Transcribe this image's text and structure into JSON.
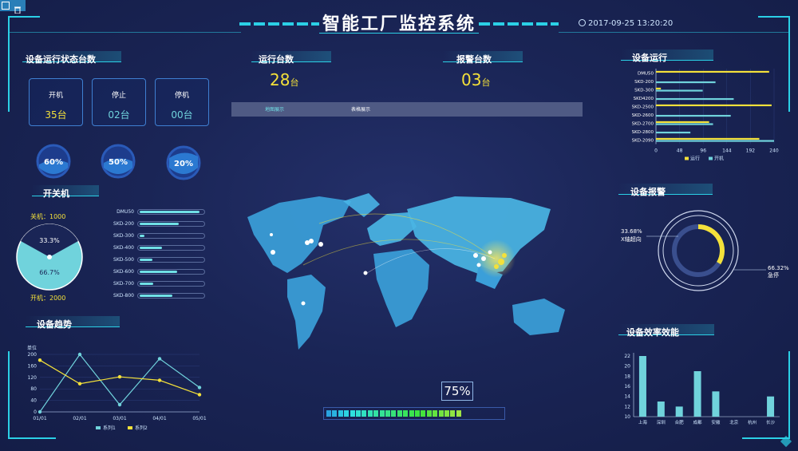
{
  "title": "智能工厂监控系统",
  "datetime": "2017-09-25 13:20:20",
  "colors": {
    "accent": "#2bd0e6",
    "yellow": "#f4e13a",
    "cyan": "#70d3dc",
    "bg": "#1a2556"
  },
  "toolbar": {
    "icons": [
      "window-icon",
      "trash-icon"
    ]
  },
  "device_status": {
    "title": "设备运行状态台数",
    "boxes": [
      {
        "label": "开机",
        "value": "35台",
        "color": "#f4e13a"
      },
      {
        "label": "停止",
        "value": "02台",
        "color": "#70d3dc"
      },
      {
        "label": "停机",
        "value": "00台",
        "color": "#70d3dc"
      }
    ],
    "rings": [
      "60%",
      "50%",
      "20%"
    ]
  },
  "power": {
    "title": "开关机",
    "off_label": "关机：1000",
    "on_label": "开机：2000",
    "off_pct": "33.3%",
    "on_pct": "66.7%",
    "bars": [
      {
        "label": "DMU50",
        "value": 0.95
      },
      {
        "label": "SKD-200",
        "value": 0.62
      },
      {
        "label": "SKD-300",
        "value": 0.08
      },
      {
        "label": "SKD-400",
        "value": 0.35
      },
      {
        "label": "SKD-500",
        "value": 0.2
      },
      {
        "label": "SKD-600",
        "value": 0.6
      },
      {
        "label": "SKD-700",
        "value": 0.22
      },
      {
        "label": "SKD-800",
        "value": 0.52
      }
    ]
  },
  "center": {
    "running_title": "运行台数",
    "running_value": "28",
    "alarm_title": "报警台数",
    "alarm_value": "03",
    "unit": "台",
    "tabs": [
      "地图展示",
      "表格展示"
    ],
    "progress_label": "75%",
    "progress_value": 0.75
  },
  "trend": {
    "title": "设备趋势",
    "unit_label": "单位",
    "legend": [
      "系列1",
      "系列2"
    ]
  },
  "device_running": {
    "title": "设备运行",
    "legend": [
      "运行",
      "开机"
    ]
  },
  "alarm": {
    "title": "设备报警",
    "left_pct": "33.68%",
    "left_label": "X轴超向",
    "right_pct": "66.32%",
    "right_label": "急停"
  },
  "efficiency": {
    "title": "设备效率效能"
  },
  "chart_data": [
    {
      "type": "line",
      "title": "设备趋势",
      "ylabel": "单位",
      "categories": [
        "01/01",
        "02/01",
        "03/01",
        "04/01",
        "05/01"
      ],
      "ylim": [
        0,
        200
      ],
      "yticks": [
        0,
        40,
        80,
        120,
        160,
        200
      ],
      "series": [
        {
          "name": "系列1",
          "color": "#70d3dc",
          "values": [
            0,
            200,
            25,
            185,
            85
          ]
        },
        {
          "name": "系列2",
          "color": "#f4e13a",
          "values": [
            180,
            98,
            122,
            110,
            60
          ]
        }
      ]
    },
    {
      "type": "bar",
      "title": "设备运行",
      "categories": [
        "DMU50",
        "SKD-200",
        "SKD-300",
        "SKD4200",
        "SKD-2500",
        "SKD-2600",
        "SKD-2700",
        "SKD-2800",
        "SKD-2090"
      ],
      "xlim": [
        0,
        240
      ],
      "xticks": [
        0,
        48,
        96,
        144,
        192,
        240
      ],
      "series": [
        {
          "name": "运行",
          "color": "#f4e13a",
          "values": [
            230,
            0,
            10,
            0,
            235,
            0,
            108,
            0,
            210
          ]
        },
        {
          "name": "开机",
          "color": "#70d3dc",
          "values": [
            0,
            121,
            95,
            158,
            0,
            152,
            116,
            70,
            240
          ]
        }
      ]
    },
    {
      "type": "pie",
      "title": "设备报警",
      "series": [
        {
          "name": "",
          "values": [
            33.68,
            66.32
          ],
          "labels": [
            "X轴超向",
            "急停"
          ]
        }
      ]
    },
    {
      "type": "bar",
      "title": "设备效率效能",
      "categories": [
        "上海",
        "深圳",
        "合肥",
        "成都",
        "安徽",
        "北京",
        "杭州",
        "长沙"
      ],
      "ylim": [
        10,
        22
      ],
      "yticks": [
        10,
        12,
        14,
        16,
        18,
        20,
        22
      ],
      "series": [
        {
          "name": "",
          "color": "#70d3dc",
          "values": [
            22,
            13,
            12,
            19,
            15,
            10,
            10,
            14
          ]
        }
      ]
    }
  ]
}
